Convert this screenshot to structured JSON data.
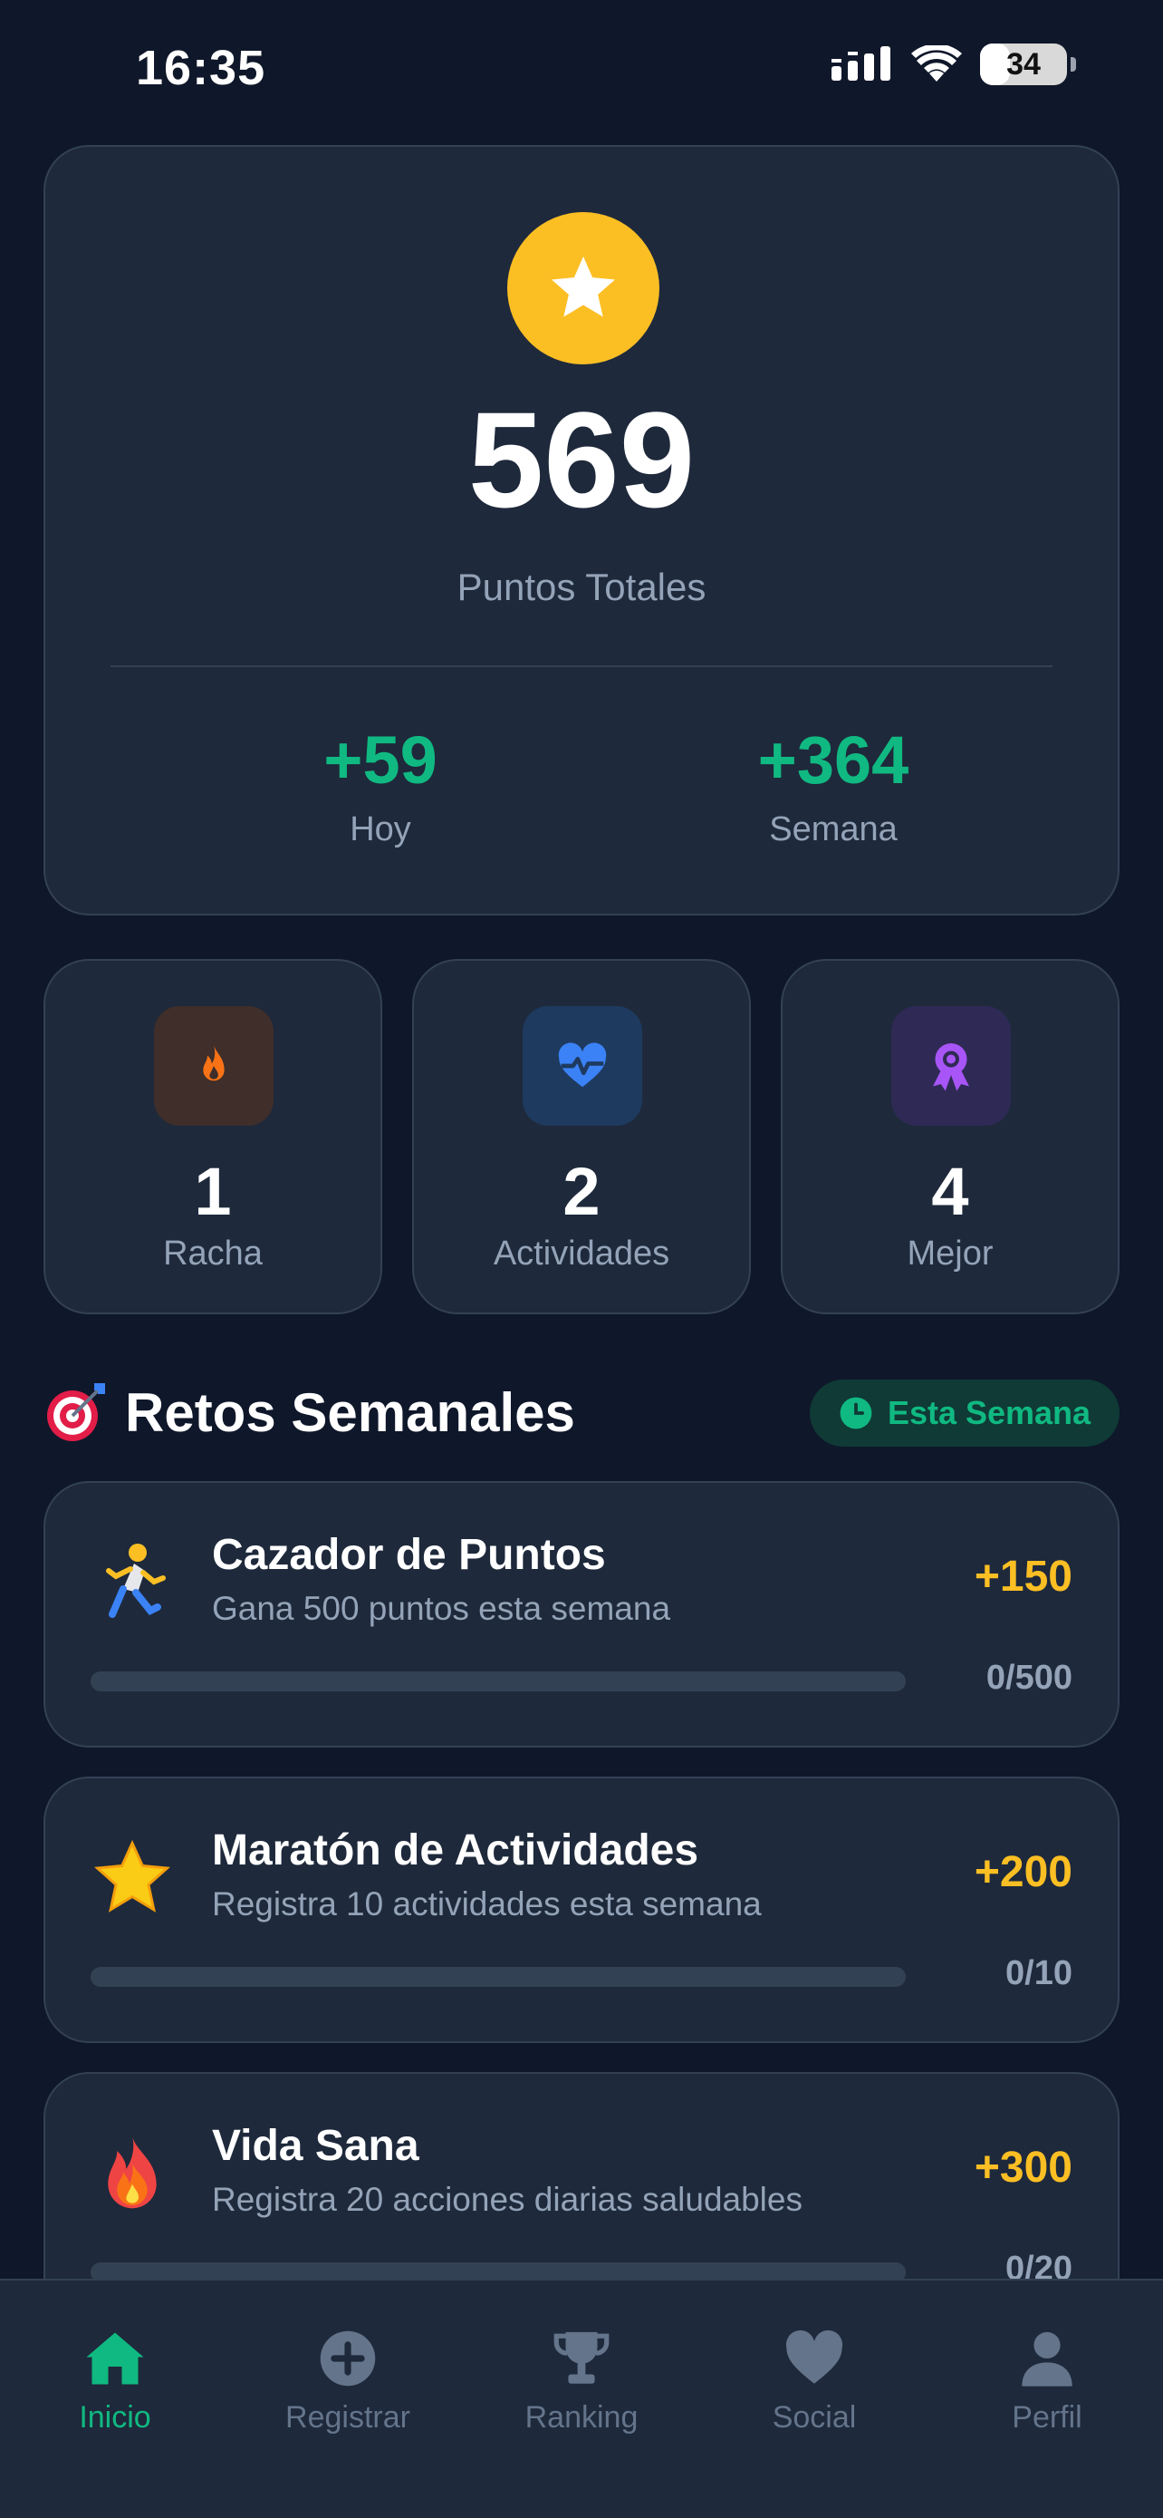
{
  "status_bar": {
    "time": "16:35",
    "battery": "34",
    "battery_level": 0.34
  },
  "points": {
    "total": "569",
    "total_label": "Puntos Totales",
    "today_value": "+59",
    "today_label": "Hoy",
    "week_value": "+364",
    "week_label": "Semana"
  },
  "stats": [
    {
      "value": "1",
      "label": "Racha",
      "icon": "flame-icon",
      "icon_color": "#f97316",
      "bg": "#3f2e2a"
    },
    {
      "value": "2",
      "label": "Actividades",
      "icon": "heart-pulse-icon",
      "icon_color": "#3b82f6",
      "bg": "#1e3a5f"
    },
    {
      "value": "4",
      "label": "Mejor",
      "icon": "award-icon",
      "icon_color": "#a855f7",
      "bg": "#2e2a55"
    }
  ],
  "challenges_section": {
    "emoji": "🎯",
    "title": "Retos Semanales",
    "badge": "Esta Semana"
  },
  "challenges": [
    {
      "emoji": "running-person-emoji",
      "title": "Cazador de Puntos",
      "description": "Gana 500 puntos esta semana",
      "points": "+150",
      "progress": "0/500",
      "progress_fraction": 0
    },
    {
      "emoji": "star-emoji",
      "title": "Maratón de Actividades",
      "description": "Registra 10 actividades esta semana",
      "points": "+200",
      "progress": "0/10",
      "progress_fraction": 0
    },
    {
      "emoji": "fire-emoji",
      "title": "Vida Sana",
      "description": "Registra 20 acciones diarias saludables",
      "points": "+300",
      "progress": "0/20",
      "progress_fraction": 0
    }
  ],
  "nav": [
    {
      "label": "Inicio",
      "icon": "home-icon",
      "active": true
    },
    {
      "label": "Registrar",
      "icon": "plus-circle-icon",
      "active": false
    },
    {
      "label": "Ranking",
      "icon": "trophy-icon",
      "active": false
    },
    {
      "label": "Social",
      "icon": "heart-icon",
      "active": false
    },
    {
      "label": "Perfil",
      "icon": "user-icon",
      "active": false
    }
  ],
  "colors": {
    "accent": "#10b981",
    "gold": "#fbbf24",
    "background": "#0f172a",
    "card": "#1e293b"
  }
}
